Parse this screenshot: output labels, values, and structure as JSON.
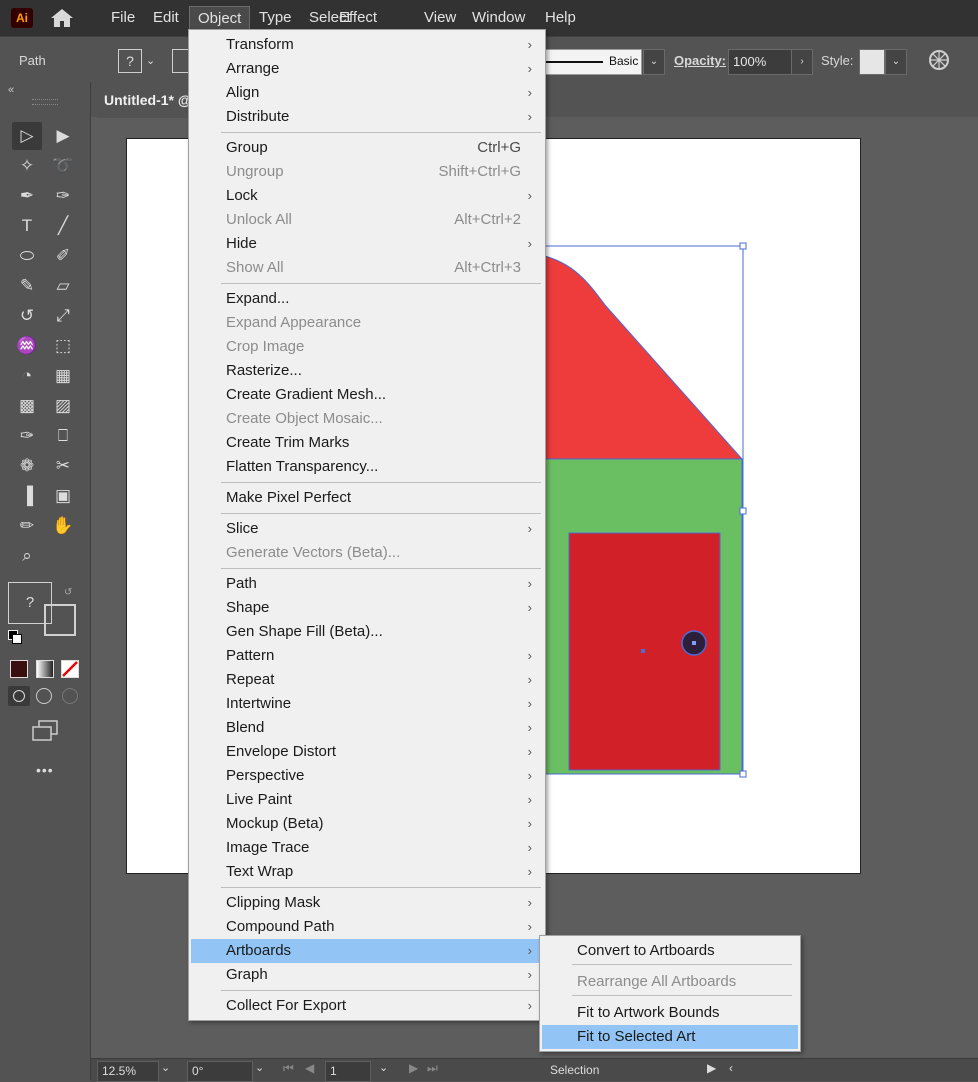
{
  "app": {
    "logo": "Ai"
  },
  "menubar": {
    "items": [
      "File",
      "Edit",
      "Object",
      "Type",
      "Select",
      "Effect",
      "View",
      "Window",
      "Help"
    ],
    "active": "Object"
  },
  "control": {
    "selection_label": "Path",
    "fill_placeholder": "?",
    "brush_label": "Basic",
    "opacity_label": "Opacity:",
    "opacity_value": "100%",
    "style_label": "Style:"
  },
  "document": {
    "tab_title": "Untitled-1* @"
  },
  "object_menu": [
    {
      "label": "Transform",
      "submenu": true
    },
    {
      "label": "Arrange",
      "submenu": true
    },
    {
      "label": "Align",
      "submenu": true
    },
    {
      "label": "Distribute",
      "submenu": true
    },
    {
      "label": "Group",
      "shortcut": "Ctrl+G"
    },
    {
      "label": "Ungroup",
      "shortcut": "Shift+Ctrl+G",
      "disabled": true
    },
    {
      "label": "Lock",
      "submenu": true
    },
    {
      "label": "Unlock All",
      "shortcut": "Alt+Ctrl+2",
      "disabled": true
    },
    {
      "label": "Hide",
      "submenu": true
    },
    {
      "label": "Show All",
      "shortcut": "Alt+Ctrl+3",
      "disabled": true
    },
    {
      "label": "Expand..."
    },
    {
      "label": "Expand Appearance",
      "disabled": true
    },
    {
      "label": "Crop Image",
      "disabled": true
    },
    {
      "label": "Rasterize..."
    },
    {
      "label": "Create Gradient Mesh..."
    },
    {
      "label": "Create Object Mosaic...",
      "disabled": true
    },
    {
      "label": "Create Trim Marks"
    },
    {
      "label": "Flatten Transparency..."
    },
    {
      "label": "Make Pixel Perfect"
    },
    {
      "label": "Slice",
      "submenu": true
    },
    {
      "label": "Generate Vectors (Beta)...",
      "disabled": true
    },
    {
      "label": "Path",
      "submenu": true
    },
    {
      "label": "Shape",
      "submenu": true
    },
    {
      "label": "Gen Shape Fill (Beta)..."
    },
    {
      "label": "Pattern",
      "submenu": true
    },
    {
      "label": "Repeat",
      "submenu": true
    },
    {
      "label": "Intertwine",
      "submenu": true
    },
    {
      "label": "Blend",
      "submenu": true
    },
    {
      "label": "Envelope Distort",
      "submenu": true
    },
    {
      "label": "Perspective",
      "submenu": true
    },
    {
      "label": "Live Paint",
      "submenu": true
    },
    {
      "label": "Mockup (Beta)",
      "submenu": true
    },
    {
      "label": "Image Trace",
      "submenu": true
    },
    {
      "label": "Text Wrap",
      "submenu": true
    },
    {
      "label": "Clipping Mask",
      "submenu": true
    },
    {
      "label": "Compound Path",
      "submenu": true
    },
    {
      "label": "Artboards",
      "submenu": true,
      "highlighted": true
    },
    {
      "label": "Graph",
      "submenu": true
    },
    {
      "label": "Collect For Export",
      "submenu": true
    }
  ],
  "artboards_submenu": [
    {
      "label": "Convert to Artboards"
    },
    {
      "label": "Rearrange All Artboards",
      "disabled": true
    },
    {
      "label": "Fit to Artwork Bounds"
    },
    {
      "label": "Fit to Selected Art",
      "highlighted": true
    }
  ],
  "statusbar": {
    "zoom": "12.5%",
    "rotation": "0°",
    "artboard_number": "1",
    "tool_name": "Selection"
  },
  "colors": {
    "roof": "#ee3b3b",
    "wall": "#6abf63",
    "door": "#d12027",
    "menu_highlight": "#92c5f5",
    "selection": "#4a6bd6"
  },
  "toolbar": {
    "icons": [
      "selection-tool-icon",
      "direct-selection-tool-icon",
      "magic-wand-icon",
      "lasso-icon",
      "pen-tool-icon",
      "curvature-tool-icon",
      "type-tool-icon",
      "line-tool-icon",
      "ellipse-tool-icon",
      "paintbrush-icon",
      "shaper-tool-icon",
      "eraser-icon",
      "rotate-tool-icon",
      "scale-tool-icon",
      "warp-tool-icon",
      "free-transform-icon",
      "shape-builder-icon",
      "perspective-grid-icon",
      "mesh-tool-icon",
      "gradient-tool-icon",
      "eyedropper-icon",
      "measure-icon",
      "symbol-sprayer-icon",
      "slice-icon",
      "graph-tool-icon",
      "artboard-tool-icon",
      "pencil-icon",
      "hand-tool-icon",
      "zoom-tool-icon"
    ],
    "fill_placeholder": "?",
    "more_label": "•••"
  }
}
